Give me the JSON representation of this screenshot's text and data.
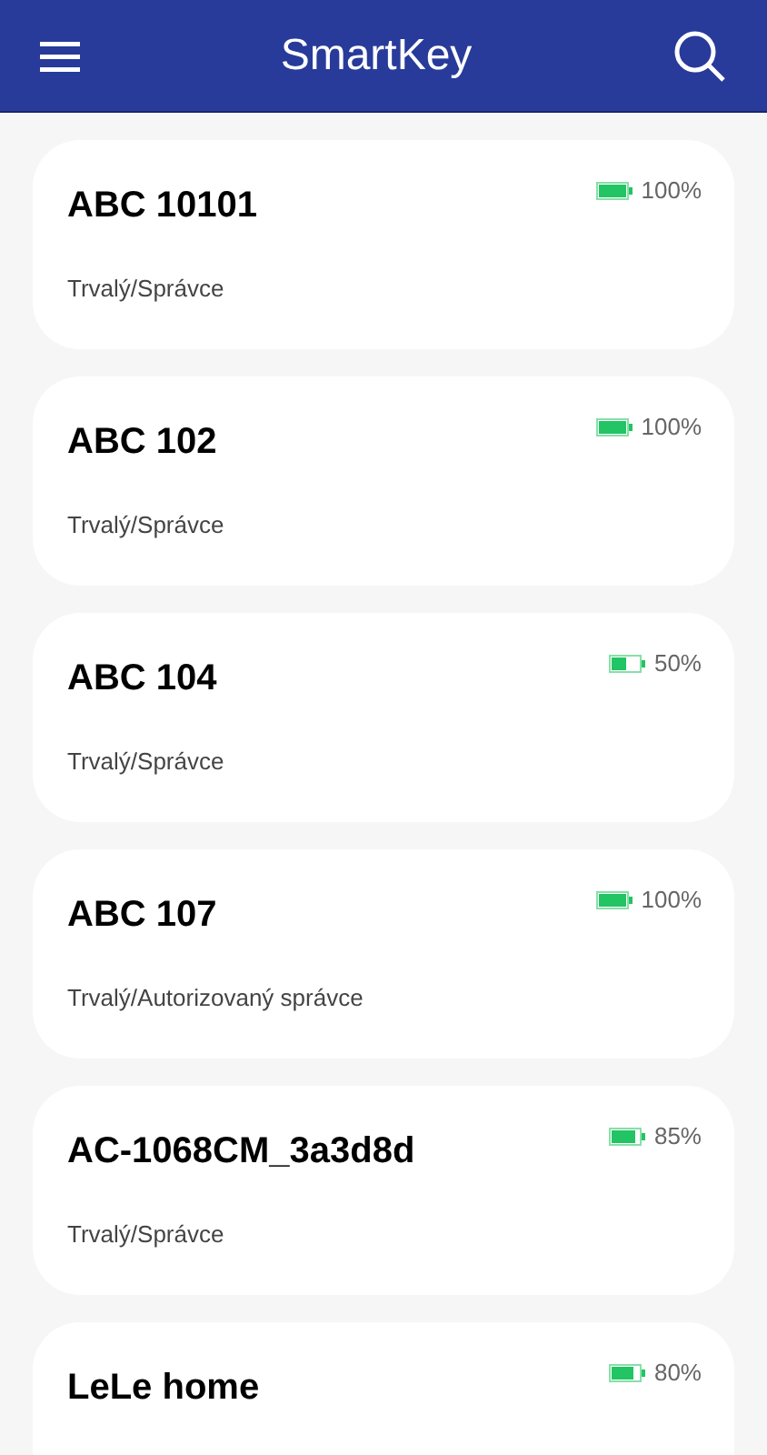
{
  "app_bar": {
    "title": "SmartKey"
  },
  "keys": [
    {
      "name": "ABC 10101",
      "battery": "100%",
      "role": "Trvalý/Správce"
    },
    {
      "name": "ABC 102",
      "battery": "100%",
      "role": "Trvalý/Správce"
    },
    {
      "name": "ABC 104",
      "battery": "50%",
      "role": "Trvalý/Správce"
    },
    {
      "name": "ABC 107",
      "battery": "100%",
      "role": "Trvalý/Autorizovaný správce"
    },
    {
      "name": "AC-1068CM_3a3d8d",
      "battery": "85%",
      "role": "Trvalý/Správce"
    },
    {
      "name": "LeLe home",
      "battery": "80%"
    }
  ]
}
